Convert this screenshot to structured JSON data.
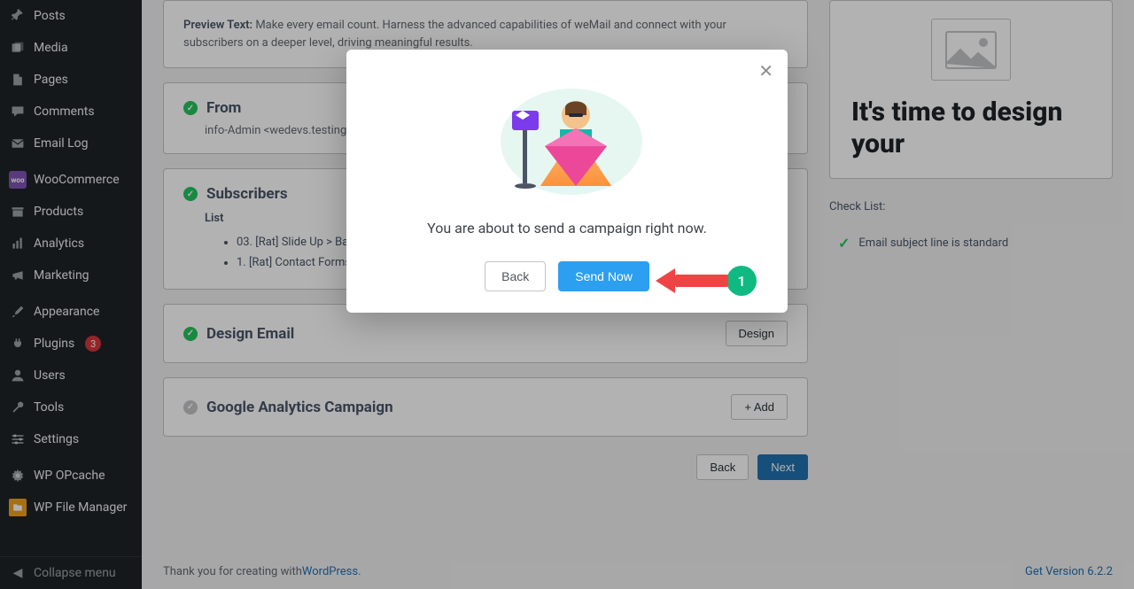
{
  "sidebar": {
    "items": [
      {
        "label": "Posts",
        "icon": "pin"
      },
      {
        "label": "Media",
        "icon": "media"
      },
      {
        "label": "Pages",
        "icon": "page"
      },
      {
        "label": "Comments",
        "icon": "comment"
      },
      {
        "label": "Email Log",
        "icon": "email"
      },
      {
        "label": "WooCommerce",
        "icon": "woo"
      },
      {
        "label": "Products",
        "icon": "archive"
      },
      {
        "label": "Analytics",
        "icon": "analytics"
      },
      {
        "label": "Marketing",
        "icon": "megaphone"
      },
      {
        "label": "Appearance",
        "icon": "brush"
      },
      {
        "label": "Plugins",
        "icon": "plug",
        "badge": "3"
      },
      {
        "label": "Users",
        "icon": "user"
      },
      {
        "label": "Tools",
        "icon": "wrench"
      },
      {
        "label": "Settings",
        "icon": "settings"
      },
      {
        "label": "WP OPcache",
        "icon": "gear"
      },
      {
        "label": "WP File Manager",
        "icon": "folder"
      }
    ],
    "collapse": "Collapse menu"
  },
  "cards": {
    "preview_label": "Preview Text:",
    "preview_text": "Make every email count. Harness the advanced capabilities of weMail and connect with your subscribers on a deeper level, driving meaningful results.",
    "from_title": "From",
    "from_value": "info-Admin <wedevs.testing",
    "subs_title": "Subscribers",
    "subs_list_label": "List",
    "subs_items": [
      "03. [Rat] Slide Up > Ba",
      "1. [Rat] Contact Forms"
    ],
    "design_title": "Design Email",
    "design_btn": "Design",
    "ga_title": "Google Analytics Campaign",
    "ga_btn": "+ Add"
  },
  "nav": {
    "back": "Back",
    "next": "Next"
  },
  "right": {
    "heading": "It's time to design your",
    "checklist_label": "Check List:",
    "checklist_item": "Email subject line is standard"
  },
  "footer": {
    "thanks": "Thank you for creating with ",
    "wp": "WordPress",
    "dot": ".",
    "version": "Get Version 6.2.2"
  },
  "modal": {
    "message": "You are about to send a campaign right now.",
    "back": "Back",
    "send": "Send Now"
  },
  "annotation": {
    "num": "1"
  }
}
